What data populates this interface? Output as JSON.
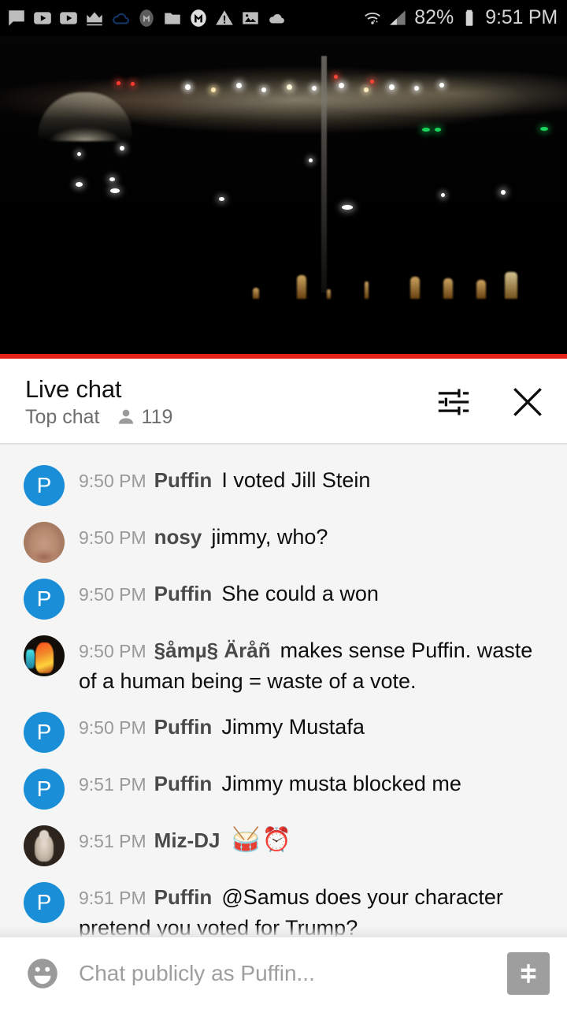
{
  "status_bar": {
    "icons": [
      {
        "name": "message-icon"
      },
      {
        "name": "youtube-play-icon"
      },
      {
        "name": "youtube-play-icon-2"
      },
      {
        "name": "crown-icon"
      },
      {
        "name": "cloud-outline-icon"
      },
      {
        "name": "mega-circle-icon"
      },
      {
        "name": "folder-icon"
      },
      {
        "name": "mega-letter-icon"
      },
      {
        "name": "warning-triangle-icon"
      },
      {
        "name": "photo-icon"
      },
      {
        "name": "cloud-filled-icon"
      }
    ],
    "wifi_icon": "wifi-icon",
    "signal_icon": "cell-signal-icon",
    "battery_percent": "82%",
    "battery_icon": "battery-icon",
    "clock": "9:51 PM"
  },
  "video": {
    "name": "live-video-player",
    "description": "night cityscape",
    "progress_percent": 100,
    "progress_color": "#e62117"
  },
  "chat_header": {
    "title": "Live chat",
    "mode": "Top chat",
    "viewer_icon": "person-icon",
    "viewer_count": "119",
    "settings_icon": "tune-sliders-icon",
    "close_icon": "close-icon"
  },
  "messages": [
    {
      "avatar_type": "letter",
      "avatar_letter": "P",
      "avatar_color": "#1a8fd8",
      "time": "9:50 PM",
      "author": "Puffin",
      "text": "I voted Jill Stein",
      "emoji": ""
    },
    {
      "avatar_type": "photo-nose",
      "avatar_letter": "",
      "avatar_color": "#b88a70",
      "time": "9:50 PM",
      "author": "nosy",
      "text": "jimmy, who?",
      "emoji": ""
    },
    {
      "avatar_type": "letter",
      "avatar_letter": "P",
      "avatar_color": "#1a8fd8",
      "time": "9:50 PM",
      "author": "Puffin",
      "text": "She could a won",
      "emoji": ""
    },
    {
      "avatar_type": "photo-samus",
      "avatar_letter": "",
      "avatar_color": "#f0892a",
      "time": "9:50 PM",
      "author": "§åmµ§ Äråñ",
      "text": "makes sense Puffin. waste of a human being = waste of a vote.",
      "emoji": ""
    },
    {
      "avatar_type": "letter",
      "avatar_letter": "P",
      "avatar_color": "#1a8fd8",
      "time": "9:50 PM",
      "author": "Puffin",
      "text": "Jimmy Mustafa",
      "emoji": ""
    },
    {
      "avatar_type": "letter",
      "avatar_letter": "P",
      "avatar_color": "#1a8fd8",
      "time": "9:51 PM",
      "author": "Puffin",
      "text": "Jimmy musta blocked me",
      "emoji": ""
    },
    {
      "avatar_type": "photo-bear",
      "avatar_letter": "",
      "avatar_color": "#c5b7a6",
      "time": "9:51 PM",
      "author": "Miz-DJ",
      "text": "",
      "emoji": "🥁⏰"
    },
    {
      "avatar_type": "letter",
      "avatar_letter": "P",
      "avatar_color": "#1a8fd8",
      "time": "9:51 PM",
      "author": "Puffin",
      "text": "@Samus does your character pretend you voted for Trump?",
      "emoji": ""
    }
  ],
  "input_bar": {
    "emoji_icon": "emoji-smiley-icon",
    "placeholder": "Chat publicly as Puffin...",
    "value": "",
    "superchat_icon": "dollar-square-icon"
  }
}
